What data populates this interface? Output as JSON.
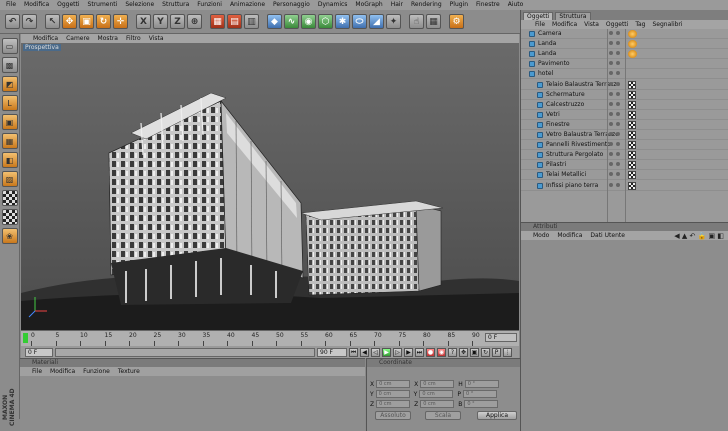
{
  "menu": [
    "File",
    "Modifica",
    "Oggetti",
    "Strumenti",
    "Selezione",
    "Struttura",
    "Funzioni",
    "Animazione",
    "Personaggio",
    "Dynamics",
    "MoGraph",
    "Hair",
    "Rendering",
    "Plugin",
    "Finestre",
    "Aiuto"
  ],
  "toolbar": {
    "x": "X",
    "y": "Y",
    "z": "Z"
  },
  "viewport": {
    "menu": [
      "Modifica",
      "Camere",
      "Mostra",
      "Filtro",
      "Vista"
    ],
    "label": "Prospettiva"
  },
  "timeline": {
    "ticks": [
      "0",
      "5",
      "10",
      "15",
      "20",
      "25",
      "30",
      "35",
      "40",
      "45",
      "50",
      "55",
      "60",
      "65",
      "70",
      "75",
      "80",
      "85",
      "90"
    ],
    "end_field": "0 F"
  },
  "transport": {
    "start": "0 F",
    "end": "90 F",
    "frame": "0 F"
  },
  "materials": {
    "title": "Materiali",
    "menu": [
      "File",
      "Modifica",
      "Funzione",
      "Texture"
    ]
  },
  "coords": {
    "title": "Coordinate",
    "rows": [
      {
        "a": "X",
        "b": "H"
      },
      {
        "a": "Y",
        "b": "P"
      },
      {
        "a": "Z",
        "b": "B"
      }
    ],
    "placeholder": "0 cm",
    "angle": "0 °",
    "mode1": "Assoluto",
    "mode2": "Scala",
    "apply": "Applica"
  },
  "objects": {
    "tabs": [
      "Oggetti",
      "Struttura"
    ],
    "menu": [
      "File",
      "Modifica",
      "Vista",
      "Oggetti",
      "Tag",
      "Segnalibri"
    ],
    "items": [
      {
        "name": "Camera",
        "indent": 0,
        "tag": "orange"
      },
      {
        "name": "Landa",
        "indent": 0,
        "tag": "orange"
      },
      {
        "name": "Landa",
        "indent": 0,
        "tag": "orange"
      },
      {
        "name": "Pavimento",
        "indent": 0,
        "tag": ""
      },
      {
        "name": "hotel",
        "indent": 0,
        "tag": ""
      },
      {
        "name": "Telaio Balaustra Terrazzo",
        "indent": 1,
        "tag": "check"
      },
      {
        "name": "Schermature",
        "indent": 1,
        "tag": "check"
      },
      {
        "name": "Calcestruzzo",
        "indent": 1,
        "tag": "check"
      },
      {
        "name": "Vetri",
        "indent": 1,
        "tag": "check"
      },
      {
        "name": "Finestre",
        "indent": 1,
        "tag": "check"
      },
      {
        "name": "Vetro Balaustra Terrazzo",
        "indent": 1,
        "tag": "check"
      },
      {
        "name": "Pannelli Rivestimento",
        "indent": 1,
        "tag": "check"
      },
      {
        "name": "Struttura Pergolato",
        "indent": 1,
        "tag": "check"
      },
      {
        "name": "Pilastri",
        "indent": 1,
        "tag": "check"
      },
      {
        "name": "Telai Metallici",
        "indent": 1,
        "tag": "check"
      },
      {
        "name": "Infissi piano terra",
        "indent": 1,
        "tag": "check"
      }
    ]
  },
  "attributes": {
    "title": "Attributi",
    "menu": [
      "Modo",
      "Modifica",
      "Dati Utente"
    ]
  },
  "brand": "MAXON CINEMA 4D"
}
